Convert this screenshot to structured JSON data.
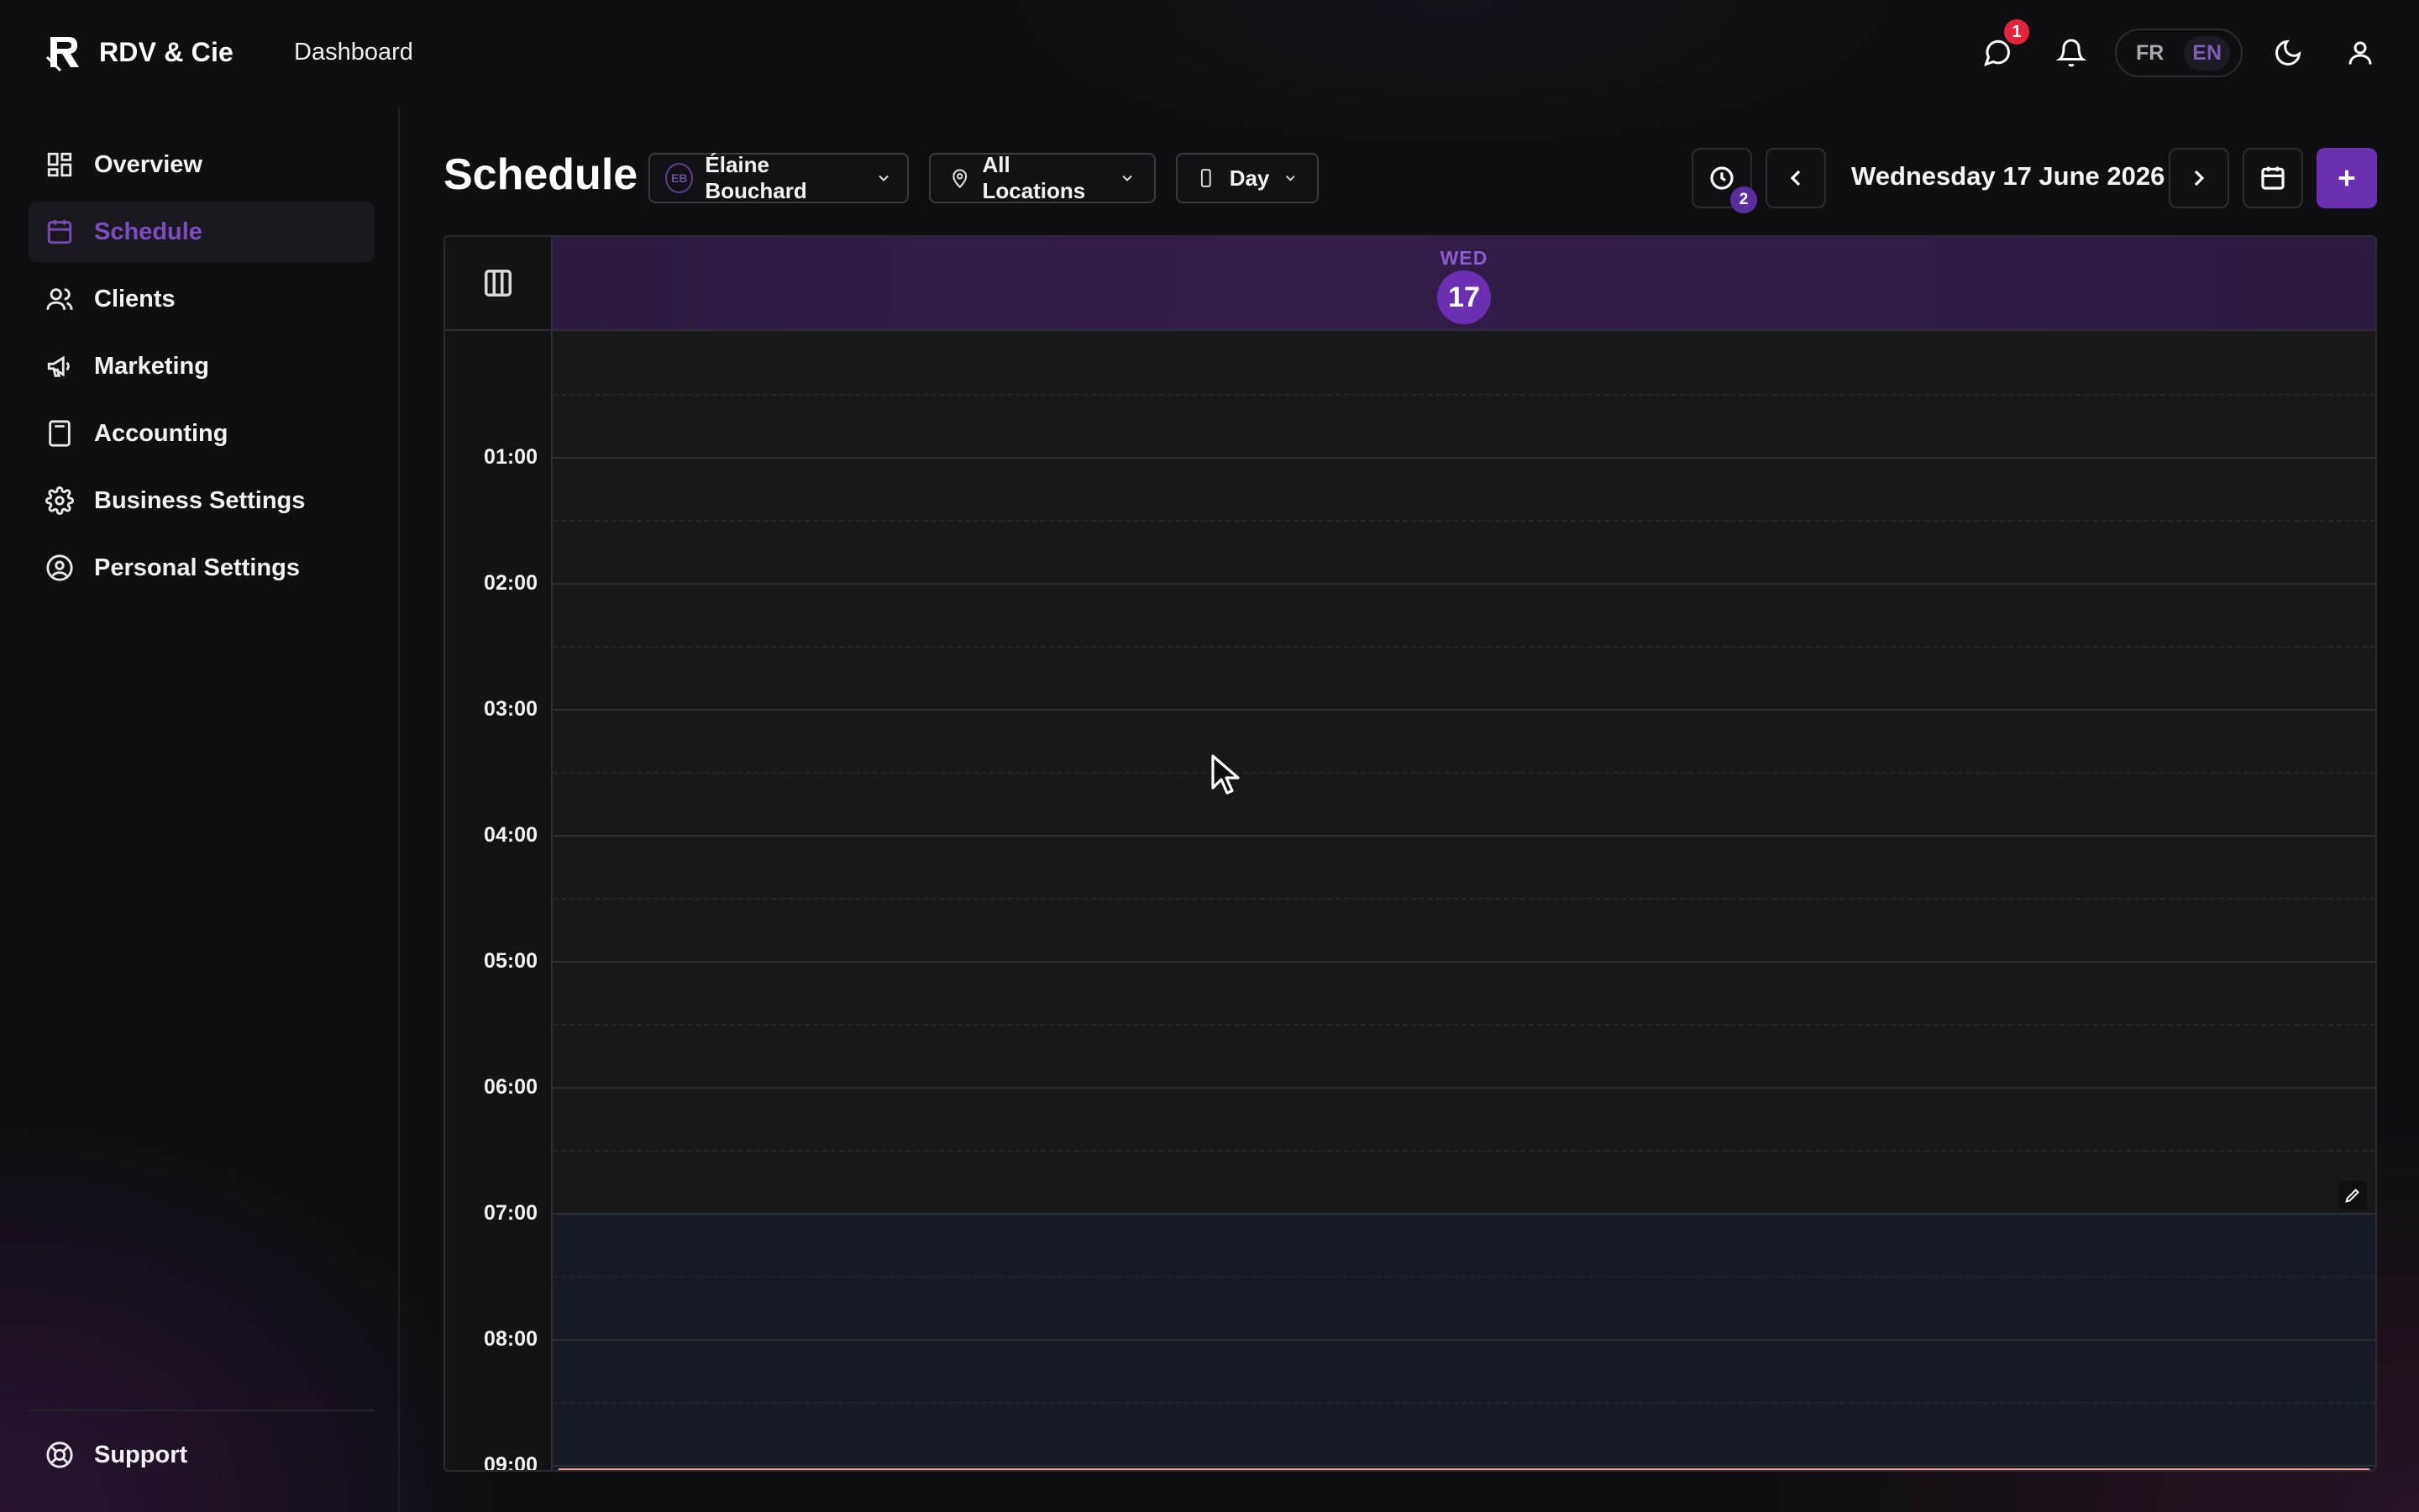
{
  "app": {
    "name": "RDV & Cie",
    "breadcrumb": "Dashboard"
  },
  "header": {
    "messages_count": "1",
    "language": {
      "options": [
        "FR",
        "EN"
      ],
      "active": "EN"
    }
  },
  "sidebar": {
    "items": [
      {
        "label": "Overview",
        "icon": "overview-grid-icon"
      },
      {
        "label": "Schedule",
        "icon": "calendar-icon",
        "active": true
      },
      {
        "label": "Clients",
        "icon": "users-icon"
      },
      {
        "label": "Marketing",
        "icon": "megaphone-icon"
      },
      {
        "label": "Accounting",
        "icon": "calculator-icon"
      },
      {
        "label": "Business Settings",
        "icon": "gear-icon"
      },
      {
        "label": "Personal Settings",
        "icon": "user-circle-icon"
      }
    ],
    "support": "Support"
  },
  "schedule": {
    "title": "Schedule",
    "staff": {
      "initials": "EB",
      "name": "Élaine Bouchard"
    },
    "location": "All Locations",
    "view": "Day",
    "pending_count": "2",
    "date_label": "Wednesday 17 June 2026",
    "day": {
      "dow": "WED",
      "num": "17"
    },
    "hours": [
      "01:00",
      "02:00",
      "03:00",
      "04:00",
      "05:00",
      "06:00",
      "07:00",
      "08:00",
      "09:00"
    ],
    "working_hours_start": "07:00"
  },
  "colors": {
    "accent": "#6b2fb1",
    "badge_red": "#e5243b",
    "now_line": "#e79a94"
  }
}
